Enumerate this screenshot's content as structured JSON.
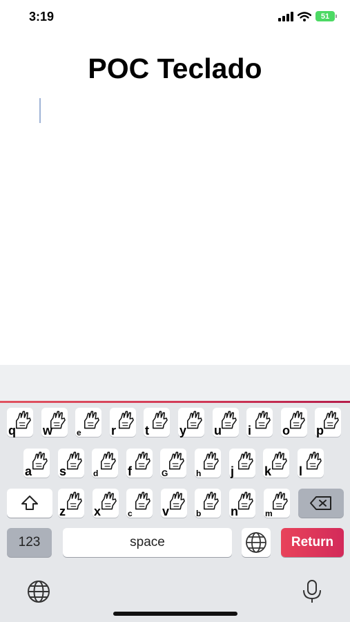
{
  "status_bar": {
    "time": "3:19",
    "battery": "51"
  },
  "page": {
    "title": "POC Teclado",
    "text_value": ""
  },
  "keyboard": {
    "rows": [
      [
        "q",
        "w",
        "e",
        "r",
        "t",
        "y",
        "u",
        "i",
        "o",
        "p"
      ],
      [
        "a",
        "s",
        "d",
        "f",
        "G",
        "h",
        "j",
        "k",
        "l"
      ],
      [
        "z",
        "x",
        "c",
        "v",
        "b",
        "n",
        "m"
      ]
    ],
    "shift_icon": "shift-icon",
    "backspace_icon": "backspace-icon",
    "numbers_label": "123",
    "globe_icon": "globe-icon",
    "space_label": "space",
    "return_label": "Return",
    "accent_color": "#d6315a"
  },
  "system_bar": {
    "globe_icon": "globe-icon",
    "mic_icon": "microphone-icon"
  }
}
